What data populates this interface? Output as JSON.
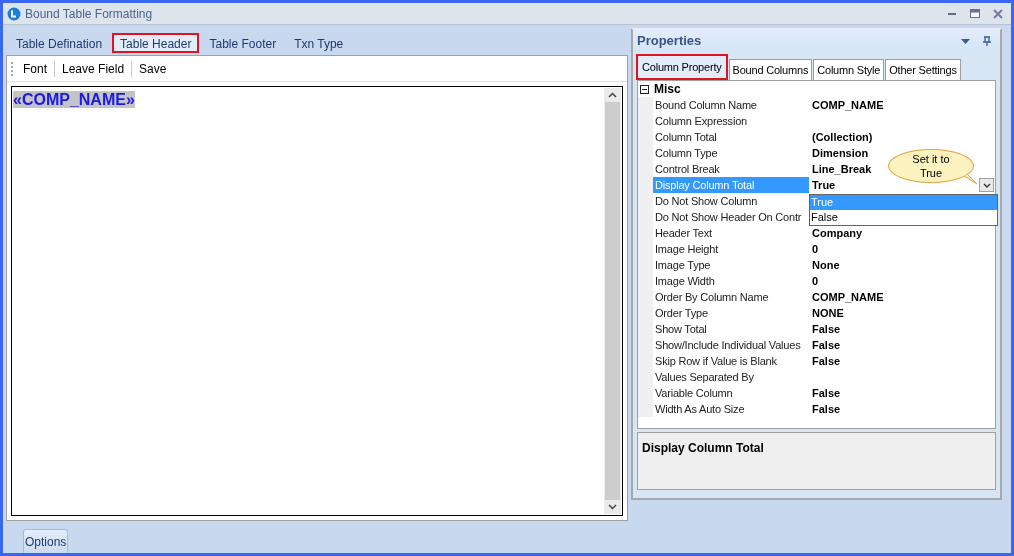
{
  "window": {
    "title": "Bound Table Formatting"
  },
  "left_tabs": [
    {
      "label": "Table Defination",
      "selected": false
    },
    {
      "label": "Table Header",
      "selected": true
    },
    {
      "label": "Table Footer",
      "selected": false
    },
    {
      "label": "Txn Type",
      "selected": false
    }
  ],
  "toolbar": [
    "Font",
    "Leave Field",
    "Save"
  ],
  "editor": {
    "text": "«COMP_NAME»",
    "selected": true
  },
  "properties": {
    "title": "Properties",
    "tabs": [
      {
        "label": "Column Property",
        "selected": true
      },
      {
        "label": "Bound Columns",
        "selected": false
      },
      {
        "label": "Column Style",
        "selected": false
      },
      {
        "label": "Other Settings",
        "selected": false
      }
    ],
    "category": {
      "label": "Misc",
      "expanded": true
    },
    "rows": [
      {
        "label": "Bound Column Name",
        "value": "COMP_NAME",
        "selected": false
      },
      {
        "label": "Column Expression",
        "selected": false
      },
      {
        "label": "Column Total",
        "value": "(Collection)",
        "selected": false
      },
      {
        "label": "Column Type",
        "value": "Dimension",
        "selected": false
      },
      {
        "label": "Control Break",
        "value": "Line_Break",
        "selected": false
      },
      {
        "label": "Display Column Total",
        "value": "True",
        "selected": true
      },
      {
        "label": "Do Not Show Column",
        "selected": false
      },
      {
        "label": "Do Not Show Header On Contr",
        "selected": false
      },
      {
        "label": "Header Text",
        "value": "Company",
        "selected": false
      },
      {
        "label": "Image Height",
        "value": "0",
        "selected": false
      },
      {
        "label": "Image Type",
        "value": "None",
        "selected": false
      },
      {
        "label": "Image Width",
        "value": "0",
        "selected": false
      },
      {
        "label": "Order By Column Name",
        "value": "COMP_NAME",
        "selected": false
      },
      {
        "label": "Order Type",
        "value": "NONE",
        "selected": false
      },
      {
        "label": "Show Total",
        "value": "False",
        "selected": false
      },
      {
        "label": "Show/Include Individual Values",
        "value": "False",
        "selected": false
      },
      {
        "label": "Skip Row if Value is Blank",
        "value": "False",
        "selected": false
      },
      {
        "label": "Values Separated By",
        "selected": false
      },
      {
        "label": "Variable Column",
        "value": "False",
        "selected": false
      },
      {
        "label": "Width As Auto Size",
        "value": "False",
        "selected": false
      }
    ],
    "dropdown_options": [
      {
        "label": "True",
        "selected": true
      },
      {
        "label": "False",
        "selected": false
      }
    ],
    "callout": "Set it to True",
    "description": "Display Column Total"
  },
  "bottom_button": "Options"
}
